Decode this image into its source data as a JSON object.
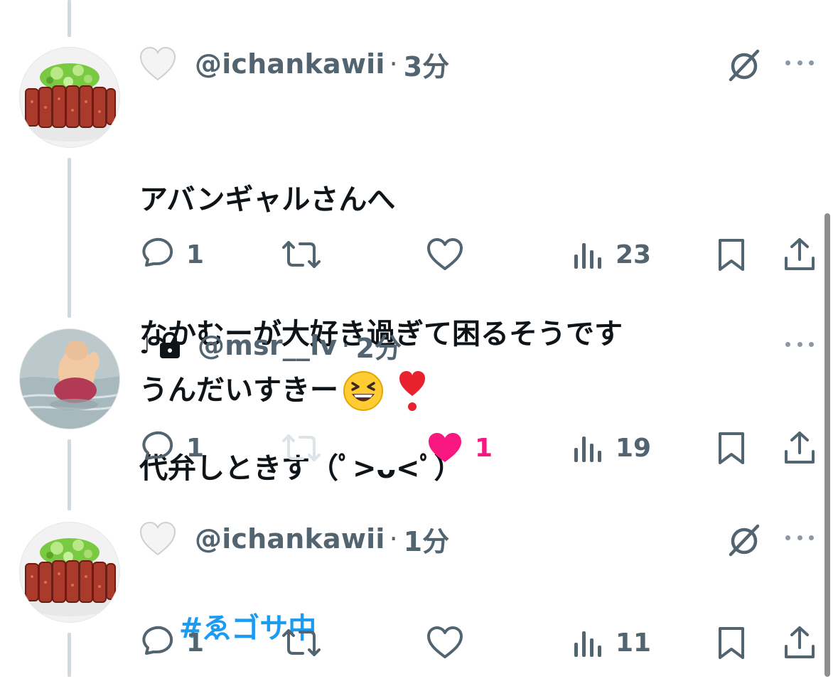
{
  "tweets": [
    {
      "handle": "@ichankawii",
      "separator": "·",
      "time": "3分",
      "lines": [
        "アバンギャルさんへ",
        "なかむーが大好き過ぎて困るそうです",
        "代弁しときす（ﾟ>ᴗ<ﾟ）"
      ],
      "actions": {
        "replies": "1",
        "retweets": "",
        "likes": "",
        "views": "23"
      },
      "icons": {
        "header": "white-heart-emoji",
        "top_right": "grok-icon",
        "menu": "more-icon"
      }
    },
    {
      "prefix": "♩",
      "handle": "@msr__lv",
      "separator": "·",
      "time": "2分",
      "text_main": "うんだいすきー",
      "emojis": [
        "😆",
        "❣️"
      ],
      "actions": {
        "replies": "1",
        "retweets": "",
        "likes": "1",
        "views": "19"
      },
      "icons": {
        "header": "lock-icon",
        "menu": "more-icon"
      }
    },
    {
      "handle": "@ichankawii",
      "separator": "·",
      "time": "1分",
      "hashtag": "#ゑゴサ中",
      "actions": {
        "replies": "1",
        "retweets": "",
        "likes": "",
        "views": "11"
      },
      "icons": {
        "header": "white-heart-emoji",
        "top_right": "grok-icon",
        "menu": "more-icon"
      }
    }
  ],
  "colors": {
    "secondary": "#536471",
    "like": "#f91880",
    "link": "#1d9bf0",
    "thread": "#cfd9de"
  }
}
